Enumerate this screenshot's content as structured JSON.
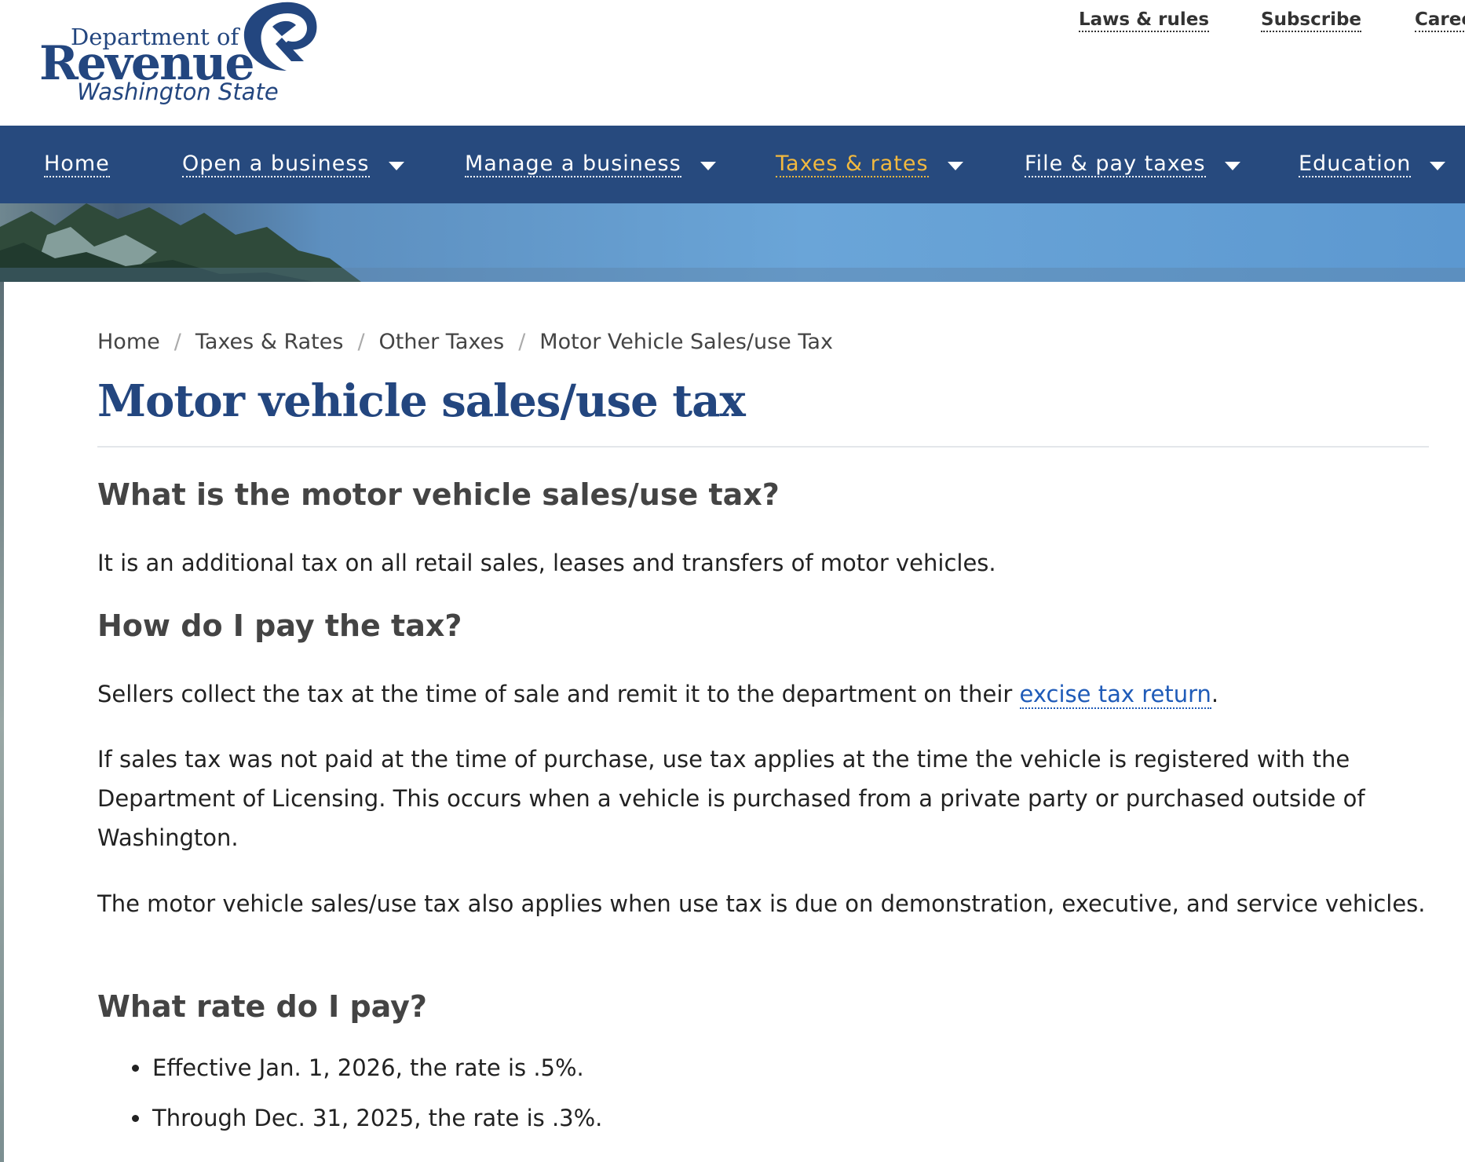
{
  "logo": {
    "line1": "Department of",
    "line2": "Revenue",
    "line3": "Washington State"
  },
  "utility_links": [
    "Laws & rules",
    "Subscribe",
    "Caree"
  ],
  "nav": {
    "items": [
      {
        "label": "Home",
        "has_dropdown": false
      },
      {
        "label": "Open a business",
        "has_dropdown": true
      },
      {
        "label": "Manage a business",
        "has_dropdown": true
      },
      {
        "label": "Taxes & rates",
        "has_dropdown": true,
        "active": true
      },
      {
        "label": "File & pay taxes",
        "has_dropdown": true
      },
      {
        "label": "Education",
        "has_dropdown": true
      }
    ]
  },
  "breadcrumb": [
    "Home",
    "Taxes & Rates",
    "Other Taxes",
    "Motor Vehicle Sales/use Tax"
  ],
  "page_title": "Motor vehicle sales/use tax",
  "sections": {
    "s1": {
      "heading": "What is the motor vehicle sales/use tax?",
      "p1": "It is an additional tax on all retail sales, leases and transfers of motor vehicles."
    },
    "s2": {
      "heading": "How do I pay the tax?",
      "p1_before_link": "Sellers collect the tax at the time of sale and remit it to the department on their ",
      "p1_link": "excise tax return",
      "p1_after_link": ".",
      "p2": "If sales tax was not paid at the time of purchase, use tax applies at the time the vehicle is registered with the Department of Licensing. This occurs when a vehicle is purchased from a private party or purchased outside of Washington.",
      "p3": "The motor vehicle sales/use tax also applies when use tax is due on demonstration, executive, and service vehicles."
    },
    "s3": {
      "heading": "What rate do I pay?",
      "bullets": [
        "Effective Jan. 1, 2026, the rate is .5%.",
        "Through Dec. 31, 2025, the rate is .3%."
      ]
    }
  },
  "colors": {
    "brand_navy": "#23467f",
    "nav_bg": "#274a7e",
    "active_nav": "#f2b93f",
    "link": "#1f5bb8"
  }
}
